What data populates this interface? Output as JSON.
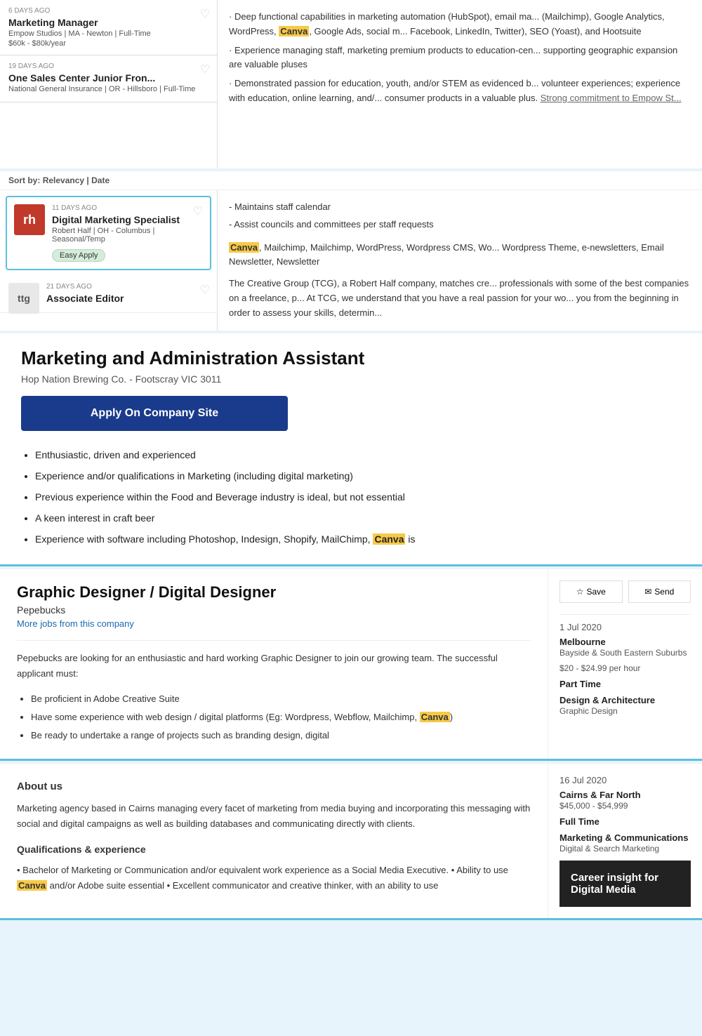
{
  "top": {
    "jobs": [
      {
        "days_ago": "6 DAYS AGO",
        "title": "Marketing Manager",
        "company": "Empow Studios",
        "location": "MA - Newton",
        "job_type": "Full-Time",
        "salary": "$60k - $80k/year"
      },
      {
        "days_ago": "19 DAYS AGO",
        "title": "One Sales Center Junior Fron...",
        "company": "National General Insurance",
        "location": "OR - Hillsboro",
        "job_type": "Full-Time"
      }
    ],
    "detail_bullets": [
      "Deep functional capabilities in marketing automation (HubSpot), email ma... (Mailchimp), Google Analytics, WordPress, Canva, Google Ads, social m... Facebook, LinkedIn, Twitter), SEO (Yoast), and Hootsuite",
      "Experience managing staff, marketing premium products to education-cen... supporting geographic expansion are valuable pluses",
      "Demonstrated passion for education, youth, and/or STEM as evidenced b... volunteer experiences; experience with education, online learning, and/... consumer products in a valuable plus. Strong commitment to Empow St..."
    ]
  },
  "middle": {
    "sort_by": "Sort by:",
    "sort_relevancy": "Relevancy",
    "sort_separator": "|",
    "sort_date": "Date",
    "rh_card": {
      "days_ago": "11 DAYS AGO",
      "title": "Digital Marketing Specialist",
      "company": "Robert Half",
      "location": "OH - Columbus",
      "job_type": "Seasonal/Temp",
      "badge": "Easy Apply",
      "logo_text": "rh"
    },
    "assoc_card": {
      "days_ago": "21 DAYS AGO",
      "title": "Associate Editor",
      "logo_text": "ttg"
    },
    "detail": {
      "maintains": "- Maintains staff calendar",
      "assist": "- Assist councils and committees per staff requests",
      "keywords": "Canva, Mailchimp, Mailchimp, WordPress, Wordpress CMS, Wo... Wordpress Theme, e-newsletters, Email Newsletter, Newsletter",
      "tcg_desc": "The Creative Group (TCG), a Robert Half company, matches cre... professionals with some of the best companies on a freelance, p... At TCG, we understand that you have a real passion for your wo... you from the beginning in order to assess your skills, determin..."
    }
  },
  "marketing": {
    "title": "Marketing and Administration Assistant",
    "company": "Hop Nation Brewing Co.  -  Footscray VIC 3011",
    "apply_btn": "Apply On Company Site",
    "bullets": [
      "Enthusiastic, driven and experienced",
      "Experience and/or qualifications in Marketing (including digital marketing)",
      "Previous experience within the Food and Beverage industry is ideal, but not essential",
      "A keen interest in craft beer",
      "Experience with software including Photoshop, Indesign, Shopify, MailChimp, Canva is"
    ]
  },
  "graphic": {
    "title": "Graphic Designer / Digital Designer",
    "company": "Pepebucks",
    "more_jobs": "More jobs from this company",
    "description": "Pepebucks are looking for an enthusiastic and hard working Graphic Designer to join our growing team. The successful applicant must:",
    "bullets": [
      "Be proficient in Adobe Creative Suite",
      "Have some experience with web design / digital platforms (Eg: Wordpress, Webflow, Mailchimp, Canva)",
      "Be ready to undertake a range of projects such as branding design, digital"
    ],
    "save_btn": "Save",
    "send_btn": "Send",
    "date": "1 Jul 2020",
    "location_label": "Melbourne",
    "location_sub": "Bayside & South Eastern Suburbs",
    "salary": "$20 - $24.99 per hour",
    "job_type_label": "Part Time",
    "category_label": "Design & Architecture",
    "category_sub": "Graphic Design"
  },
  "aboutus": {
    "title": "About us",
    "description": "Marketing agency based in Cairns managing every facet of marketing from media buying and incorporating this messaging with social and digital campaigns as well as building databases and communicating directly with clients.",
    "qual_title": "Qualifications & experience",
    "qual_text": "• Bachelor of Marketing or Communication and/or equivalent work experience as a Social Media Executive. • Ability to use Canva and/or Adobe suite essential • Excellent communicator and creative thinker, with an ability to use",
    "date": "16 Jul 2020",
    "location_label": "Cairns & Far North",
    "salary": "$45,000 - $54,999",
    "job_type_label": "Full Time",
    "category_label": "Marketing & Communications",
    "category_sub": "Digital & Search Marketing",
    "career_title": "Career insight for Digital Media"
  }
}
